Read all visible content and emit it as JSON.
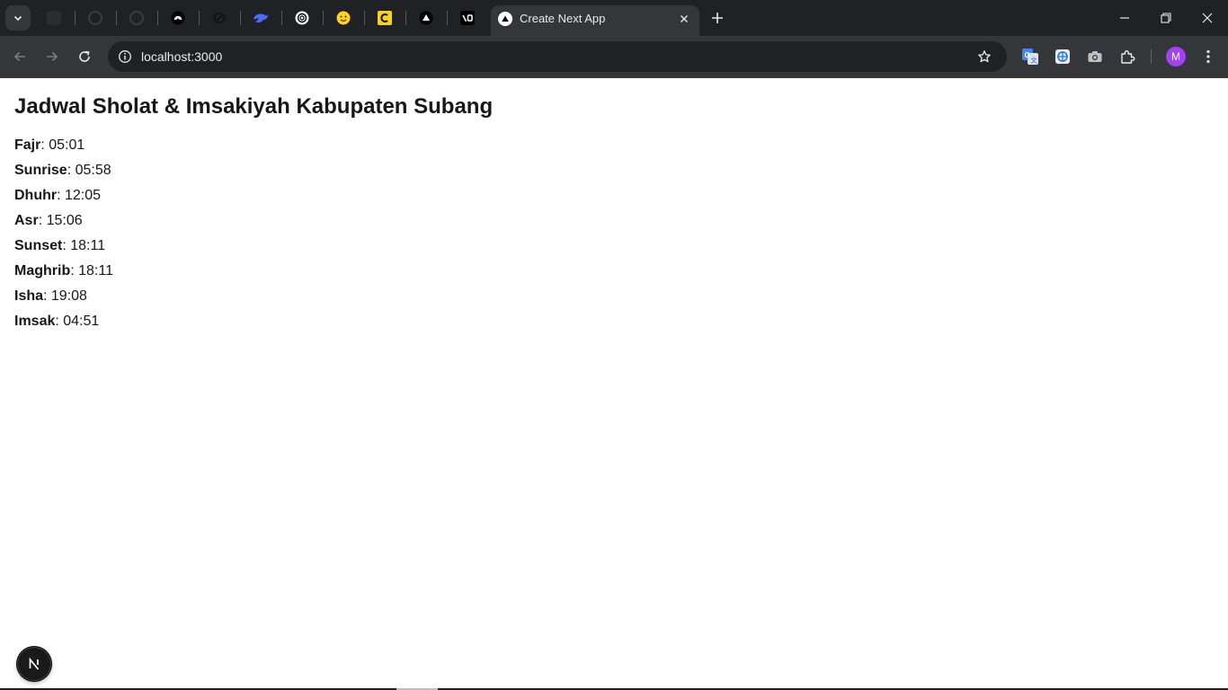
{
  "browser": {
    "active_tab": {
      "title": "Create Next App"
    },
    "address_bar": {
      "url": "localhost:3000"
    },
    "profile": {
      "initial": "M",
      "color": "#a142f4"
    },
    "pinned_tab_icons": [
      "dark-tab-icon",
      "github-icon",
      "github-icon",
      "openai-icon",
      "loop-icon",
      "deepseek-icon",
      "openai-icon",
      "huggingface-icon",
      "claude-icon",
      "vercel-icon",
      "v0-icon"
    ],
    "extension_icons": [
      "google-translate-icon",
      "webpage-icon",
      "camera-icon",
      "extensions-icon"
    ]
  },
  "page": {
    "heading": "Jadwal Sholat & Imsakiyah Kabupaten Subang",
    "times": [
      {
        "label": "Fajr",
        "value": ": 05:01"
      },
      {
        "label": "Sunrise",
        "value": ": 05:58"
      },
      {
        "label": "Dhuhr",
        "value": ": 12:05"
      },
      {
        "label": "Asr",
        "value": ": 15:06"
      },
      {
        "label": "Sunset",
        "value": ": 18:11"
      },
      {
        "label": "Maghrib",
        "value": ": 18:11"
      },
      {
        "label": "Isha",
        "value": ": 19:08"
      },
      {
        "label": "Imsak",
        "value": ": 04:51"
      }
    ]
  },
  "dev_badge": {
    "letter": "N"
  }
}
